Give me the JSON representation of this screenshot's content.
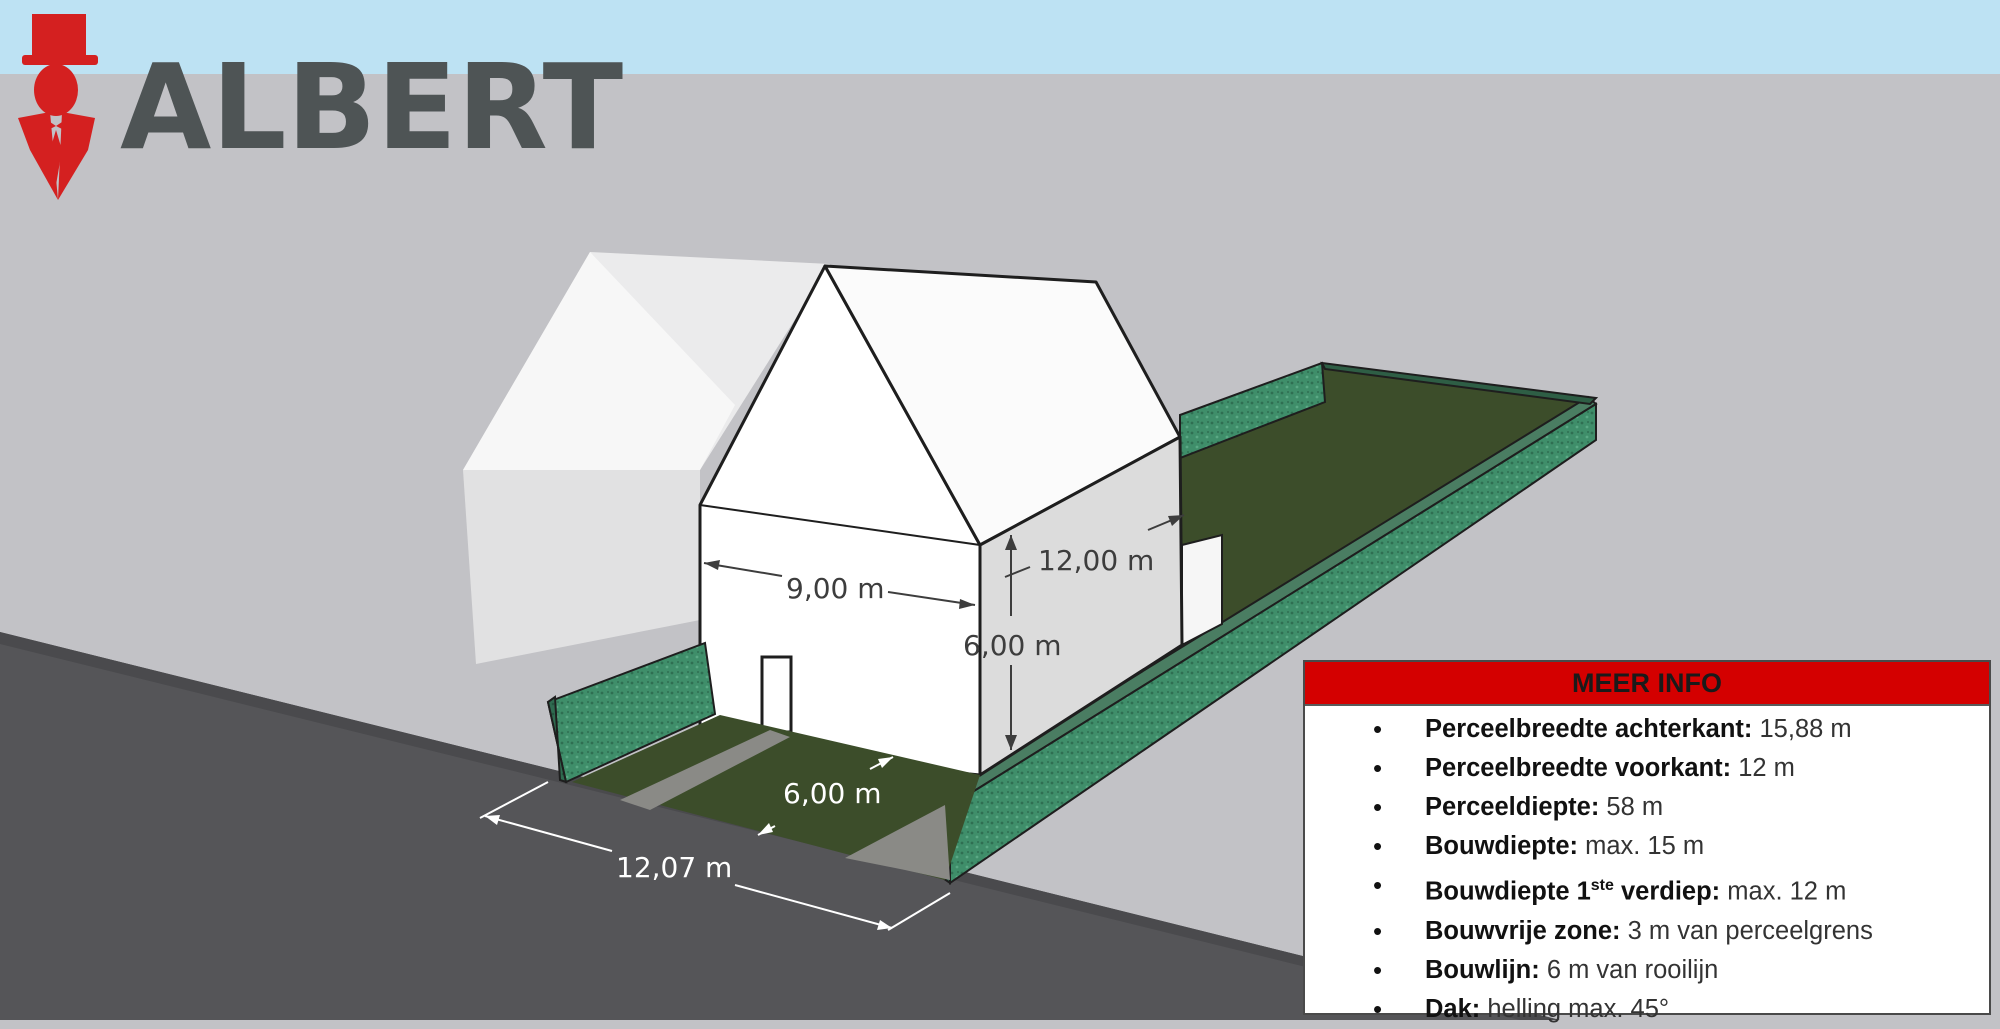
{
  "logo": {
    "text": "ALBERT"
  },
  "dimensions": {
    "house_width": "9,00 m",
    "house_depth": "12,00 m",
    "house_height": "6,00 m",
    "setback": "6,00 m",
    "plot_front": "12,07 m"
  },
  "info": {
    "title": "MEER INFO",
    "items": [
      {
        "label": "Perceelbreedte achterkant:",
        "value": " 15,88 m"
      },
      {
        "label": "Perceelbreedte voorkant:",
        "value": " 12 m"
      },
      {
        "label": "Perceeldiepte:",
        "value": " 58 m"
      },
      {
        "label": "Bouwdiepte:",
        "value": " max. 15 m"
      },
      {
        "label_pre": "Bouwdiepte 1",
        "label_sup": "ste",
        "label_post": " verdiep:",
        "value": " max. 12 m"
      },
      {
        "label": "Bouwvrije zone:",
        "value": " 3 m van perceelgrens"
      },
      {
        "label": "Bouwlijn:",
        "value": " 6 m van rooilijn"
      },
      {
        "label": "Dak:",
        "value": " helling max. 45°"
      }
    ]
  },
  "colors": {
    "sky": "#bde2f3",
    "ground": "#c2c2c6",
    "road": "#555558",
    "lawn": "#3c4d2a",
    "hedge": "#3f8e6a",
    "accent": "#d40000",
    "logo_text": "#4e5455"
  }
}
